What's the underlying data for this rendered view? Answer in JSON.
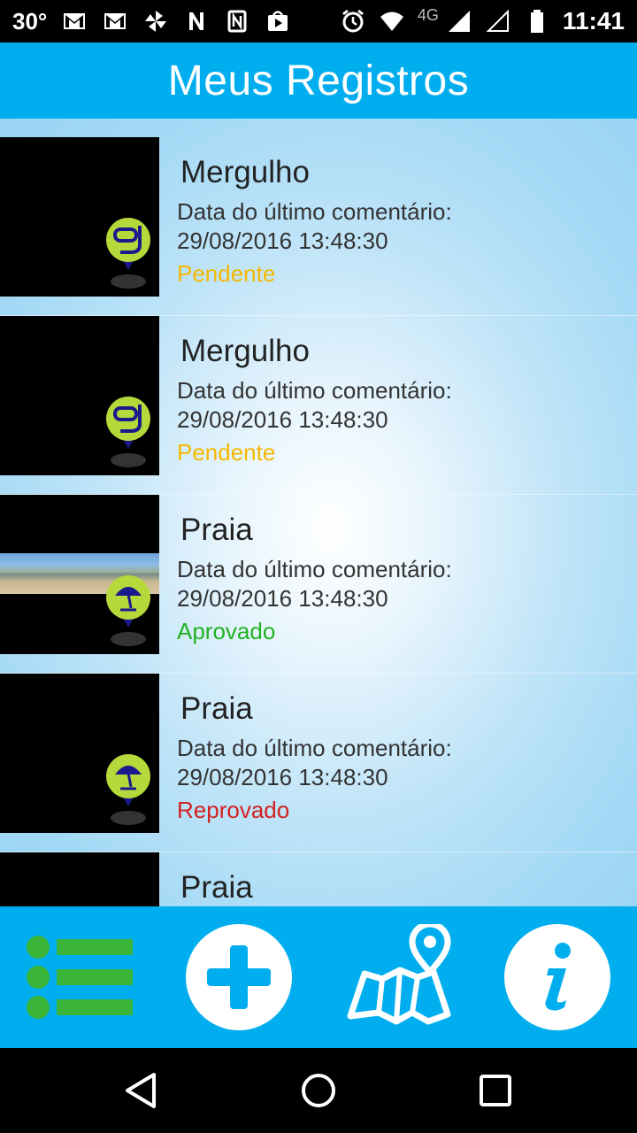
{
  "status_bar": {
    "temperature": "30°",
    "network": "4G",
    "time": "11:41",
    "icons": [
      "gmail-icon",
      "gmail-icon",
      "pinwheel-icon",
      "n-icon",
      "nfc-icon",
      "play-store-icon",
      "alarm-icon",
      "wifi-icon",
      "signal-icon",
      "signal-empty-icon",
      "battery-icon"
    ]
  },
  "header": {
    "title": "Meus Registros"
  },
  "records": [
    {
      "title": "Mergulho",
      "label": "Data do último comentário:",
      "date": "29/08/2016 13:48:30",
      "status": "Pendente",
      "status_color": "#f5b800",
      "thumb": "black",
      "pin_icon": "snorkel-icon"
    },
    {
      "title": "Mergulho",
      "label": "Data do último comentário:",
      "date": "29/08/2016 13:48:30",
      "status": "Pendente",
      "status_color": "#f5b800",
      "thumb": "black",
      "pin_icon": "snorkel-icon"
    },
    {
      "title": "Praia",
      "label": "Data do último comentário:",
      "date": "29/08/2016 13:48:30",
      "status": "Aprovado",
      "status_color": "#22b222",
      "thumb": "beach-panorama",
      "pin_icon": "umbrella-icon"
    },
    {
      "title": "Praia",
      "label": "Data do último comentário:",
      "date": "29/08/2016 13:48:30",
      "status": "Reprovado",
      "status_color": "#d42020",
      "thumb": "black",
      "pin_icon": "umbrella-icon"
    },
    {
      "title": "Praia",
      "label": "",
      "date": "",
      "status": "",
      "status_color": "#333333",
      "thumb": "black",
      "pin_icon": ""
    }
  ],
  "tab_bar": {
    "tabs": [
      "list-icon",
      "add-icon",
      "map-pin-icon",
      "info-icon"
    ],
    "accent": "#00aeef",
    "active_color": "#3ab53a"
  },
  "nav_bar": {
    "buttons": [
      "back-icon",
      "home-icon",
      "recents-icon"
    ]
  }
}
